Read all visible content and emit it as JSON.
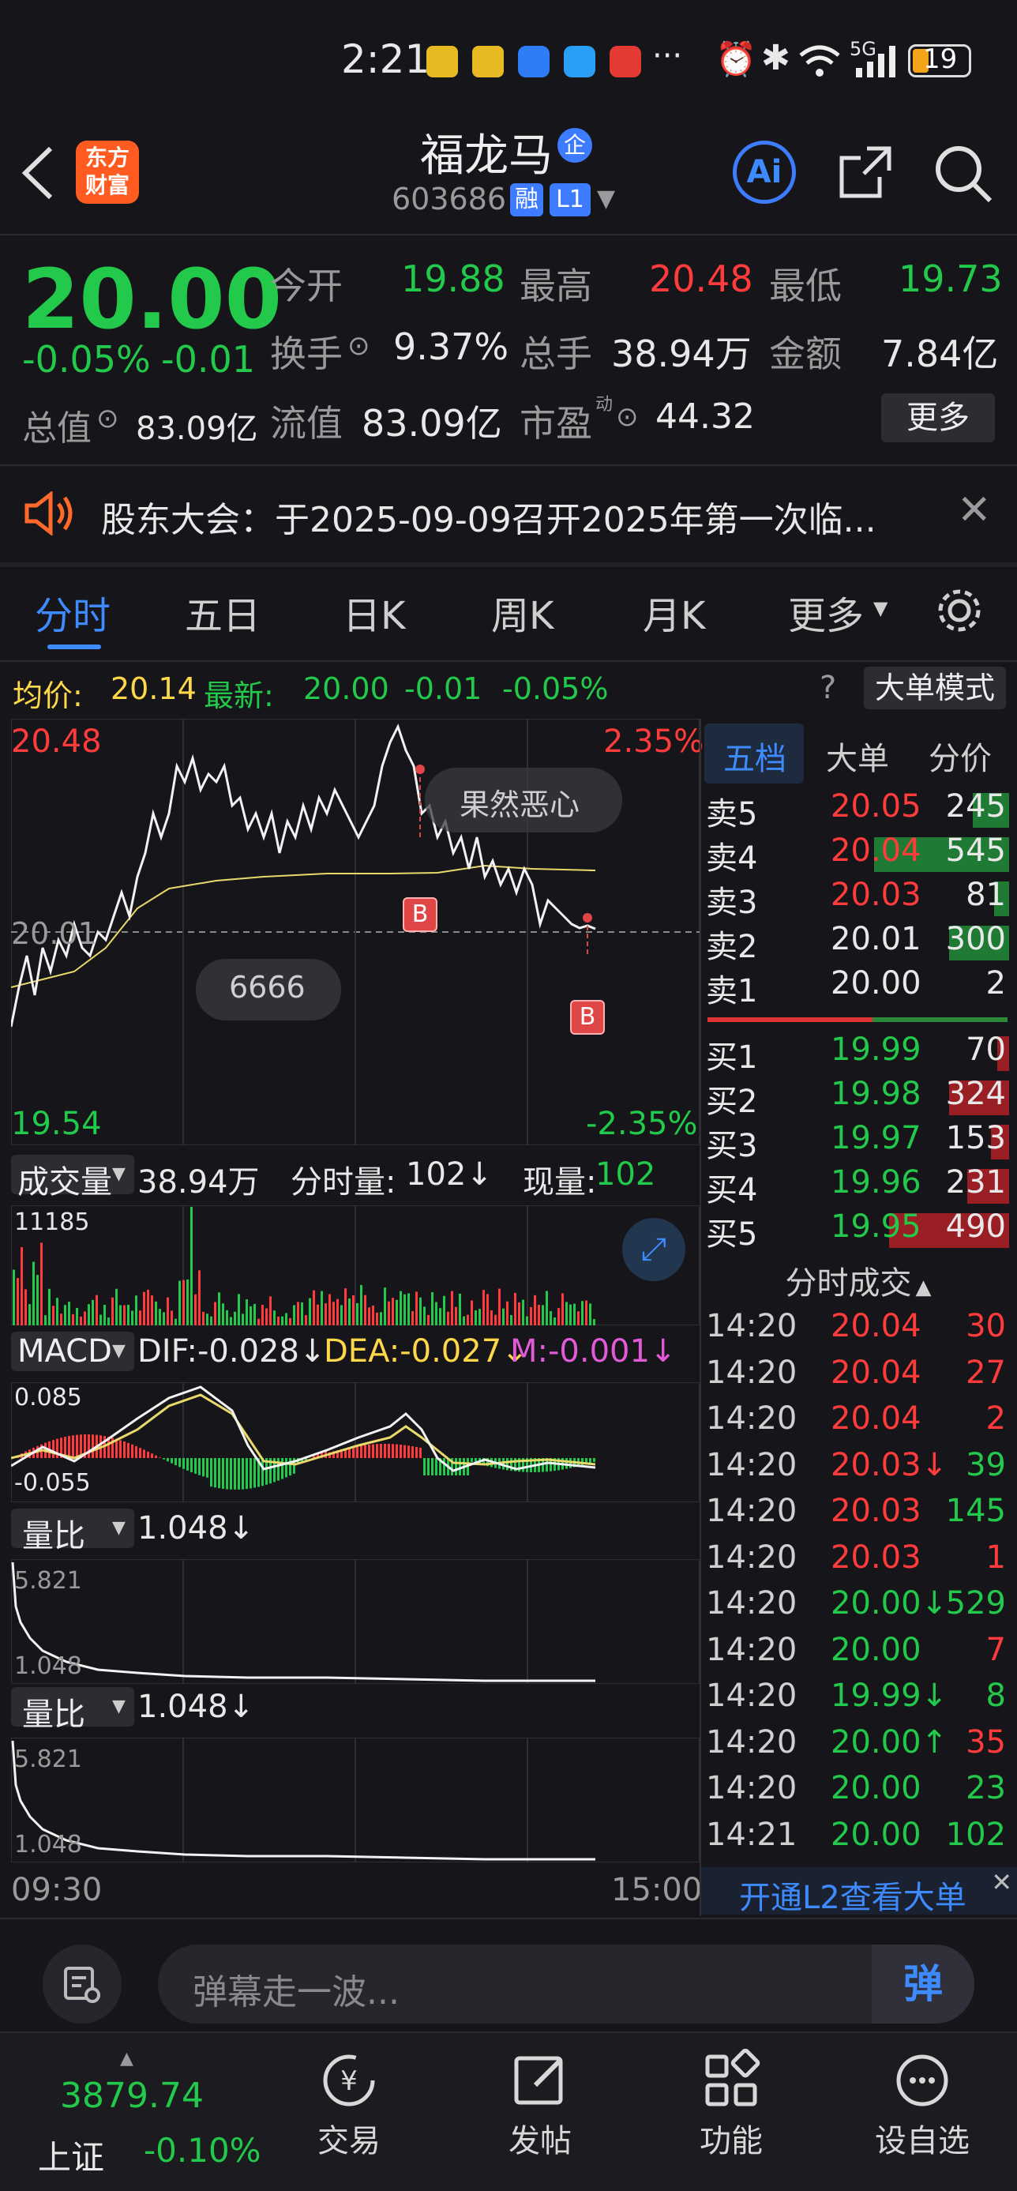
{
  "status_bar": {
    "time": "2:21",
    "battery": "19",
    "more": "···",
    "network": "5G"
  },
  "header": {
    "logo_line1": "东方",
    "logo_line2": "财富",
    "stock_name": "福龙马",
    "stock_code": "603686",
    "badge_rong": "融",
    "badge_l1": "L1",
    "badge_qi": "企",
    "ai_label": "Ai"
  },
  "quote": {
    "price": "20.00",
    "change_pct": "-0.05%",
    "change": "-0.01",
    "open_label": "今开",
    "open": "19.88",
    "high_label": "最高",
    "high": "20.48",
    "low_label": "最低",
    "low": "19.73",
    "turnover_label": "换手",
    "turnover": "9.37%",
    "volume_label": "总手",
    "volume": "38.94万",
    "amount_label": "金额",
    "amount": "7.84亿",
    "mktcap_label": "总值",
    "mktcap": "83.09亿",
    "float_label": "流值",
    "float_cap": "83.09亿",
    "pe_label": "市盈",
    "pe_sup": "动",
    "pe": "44.32",
    "more_label": "更多"
  },
  "notice": {
    "text": "股东大会：于2025-09-09召开2025年第一次临..."
  },
  "tabs": [
    "分时",
    "五日",
    "日K",
    "周K",
    "月K",
    "更多"
  ],
  "info_line": {
    "avg_label": "均价:",
    "avg": "20.14",
    "latest_label": "最新:",
    "latest": "20.00",
    "chg": "-0.01",
    "pct": "-0.05%",
    "big_order_mode": "大单模式"
  },
  "chart_labels": {
    "high_price": "20.48",
    "high_pct": "2.35%",
    "low_price": "19.54",
    "low_pct": "-2.35%",
    "mid_price": "20.01",
    "bubble1": "果然恶心",
    "bubble2": "6666",
    "marker": "B",
    "time_start": "09:30",
    "time_end": "15:00"
  },
  "volume_panel": {
    "label": "成交量",
    "total": "38.94万",
    "tick_vol_label": "分时量:",
    "tick_vol": "102↓",
    "cur_label": "现量:",
    "cur": "102",
    "max": "11185"
  },
  "macd_panel": {
    "label": "MACD",
    "dif": "DIF:-0.028↓",
    "dea": "DEA:-0.027↓",
    "m": "M:-0.001↓",
    "top": "0.085",
    "bottom": "-0.055"
  },
  "ratio_panel1": {
    "label": "量比",
    "value": "1.048↓",
    "top": "5.821",
    "bottom": "1.048"
  },
  "ratio_panel2": {
    "label": "量比",
    "value": "1.048↓",
    "top": "5.821",
    "bottom": "1.048"
  },
  "orderbook_tabs": [
    "五档",
    "大单",
    "分价"
  ],
  "asks": [
    {
      "label": "卖5",
      "price": "20.05",
      "vol": "245",
      "bar": 0.12
    },
    {
      "label": "卖4",
      "price": "20.04",
      "vol": "545",
      "bar": 0.45
    },
    {
      "label": "卖3",
      "price": "20.03",
      "vol": "81",
      "bar": 0.05
    },
    {
      "label": "卖2",
      "price": "20.01",
      "vol": "300",
      "bar": 0.2
    },
    {
      "label": "卖1",
      "price": "20.00",
      "vol": "2",
      "bar": 0.0
    }
  ],
  "bids": [
    {
      "label": "买1",
      "price": "19.99",
      "vol": "70",
      "bar": 0.04
    },
    {
      "label": "买2",
      "price": "19.98",
      "vol": "324",
      "bar": 0.2
    },
    {
      "label": "买3",
      "price": "19.97",
      "vol": "153",
      "bar": 0.06
    },
    {
      "label": "买4",
      "price": "19.96",
      "vol": "231",
      "bar": 0.14
    },
    {
      "label": "买5",
      "price": "19.95",
      "vol": "490",
      "bar": 0.4
    }
  ],
  "ticks_title": "分时成交",
  "ticks": [
    {
      "time": "14:20",
      "price": "20.04",
      "vol": "30",
      "pc": "red",
      "vc": "red"
    },
    {
      "time": "14:20",
      "price": "20.04",
      "vol": "27",
      "pc": "red",
      "vc": "red"
    },
    {
      "time": "14:20",
      "price": "20.04",
      "vol": "2",
      "pc": "red",
      "vc": "red"
    },
    {
      "time": "14:20",
      "price": "20.03↓",
      "vol": "39",
      "pc": "red",
      "vc": "green"
    },
    {
      "time": "14:20",
      "price": "20.03",
      "vol": "145",
      "pc": "red",
      "vc": "green"
    },
    {
      "time": "14:20",
      "price": "20.03",
      "vol": "1",
      "pc": "red",
      "vc": "red"
    },
    {
      "time": "14:20",
      "price": "20.00↓",
      "vol": "529",
      "pc": "green",
      "vc": "green"
    },
    {
      "time": "14:20",
      "price": "20.00",
      "vol": "7",
      "pc": "green",
      "vc": "red"
    },
    {
      "time": "14:20",
      "price": "19.99↓",
      "vol": "8",
      "pc": "green",
      "vc": "green"
    },
    {
      "time": "14:20",
      "price": "20.00↑",
      "vol": "35",
      "pc": "green",
      "vc": "red"
    },
    {
      "time": "14:20",
      "price": "20.00",
      "vol": "23",
      "pc": "green",
      "vc": "green"
    },
    {
      "time": "14:21",
      "price": "20.00",
      "vol": "102",
      "pc": "green",
      "vc": "green"
    }
  ],
  "l2_banner": "开通L2查看大单",
  "comment": {
    "placeholder": "弹幕走一波...",
    "send": "弹"
  },
  "bottom_nav": {
    "index_value": "3879.74",
    "index_name": "上证",
    "index_pct": "-0.10%",
    "items": [
      "交易",
      "发帖",
      "功能",
      "设自选"
    ]
  },
  "colors": {
    "up": "#ff3b3b",
    "down": "#22c94a",
    "accent": "#3d8bff",
    "avg_line": "#e8d96a"
  }
}
